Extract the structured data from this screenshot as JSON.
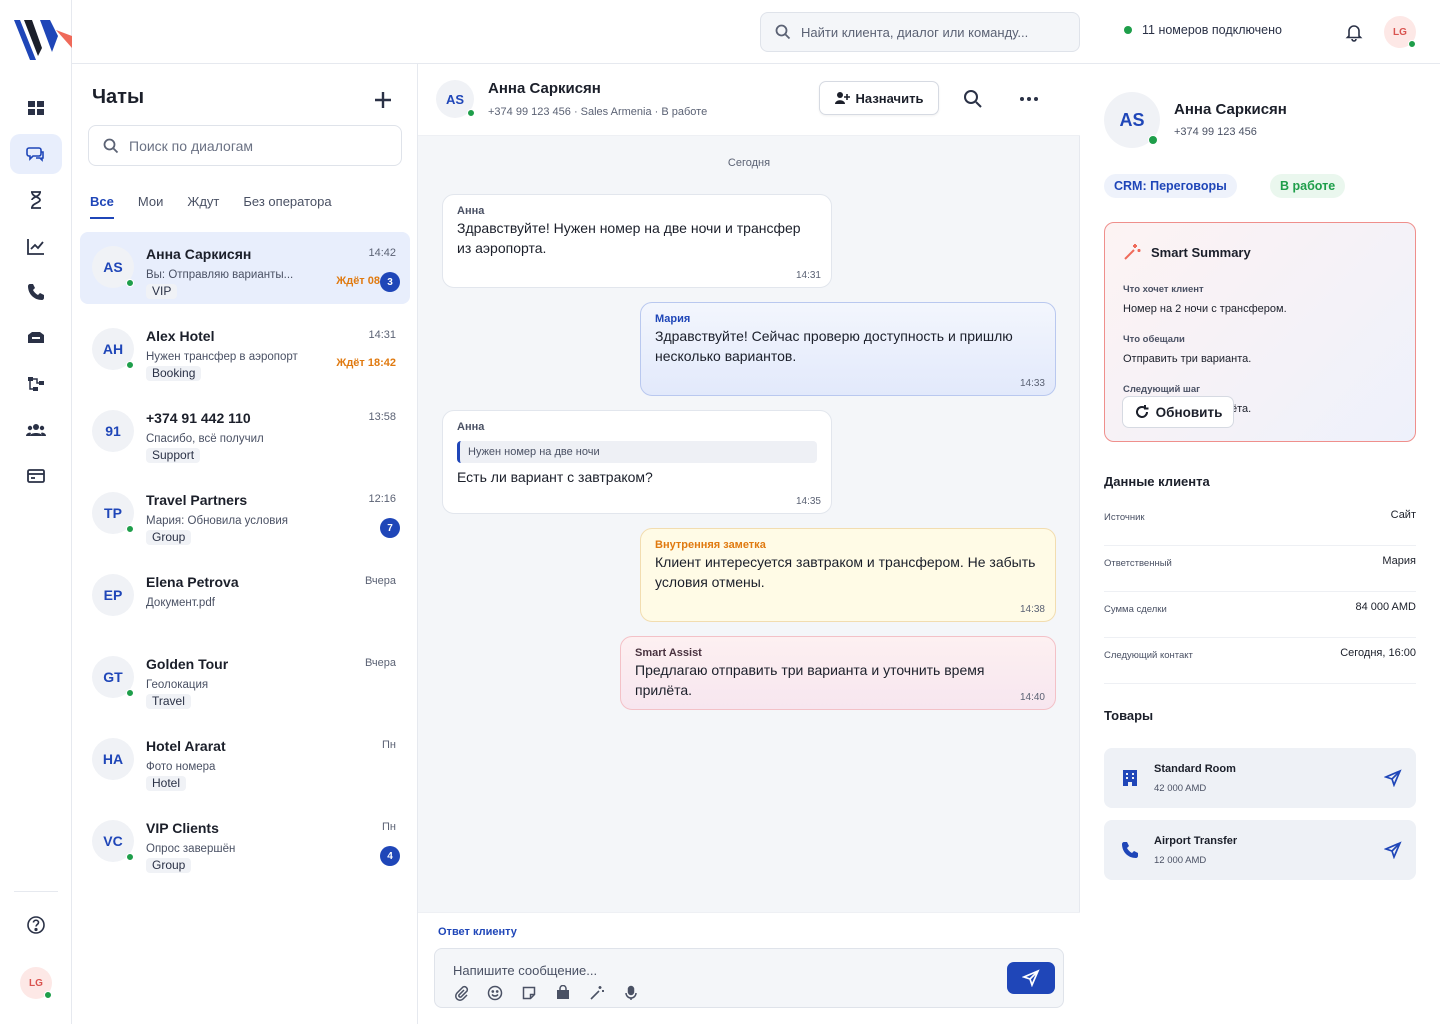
{
  "topbar": {
    "search_placeholder": "Найти клиента, диалог или команду...",
    "numbers_status": "11 номеров подключено",
    "user_initials": "LG"
  },
  "rail": {
    "items": [
      "dashboard-icon",
      "chats-icon",
      "hourglass-icon",
      "analytics-icon",
      "phone-icon",
      "inbox-icon",
      "flow-icon",
      "team-icon",
      "billing-icon"
    ],
    "help_icon": "help-icon",
    "user_initials": "LG"
  },
  "chats": {
    "title": "Чаты",
    "search_placeholder": "Поиск по диалогам",
    "filters": [
      "Все",
      "Мои",
      "Ждут",
      "Без оператора"
    ],
    "items": [
      {
        "initials": "AS",
        "name": "Анна Саркисян",
        "time": "14:42",
        "preview": "Вы: Отправляю варианты...",
        "tag": "VIP",
        "wait": "Ждёт 08",
        "badge": "3",
        "online": true
      },
      {
        "initials": "AH",
        "name": "Alex Hotel",
        "time": "14:31",
        "preview": "Нужен трансфер в аэропорт",
        "tag": "Booking",
        "wait": "Ждёт 18:42",
        "badge": "",
        "online": true
      },
      {
        "initials": "91",
        "name": "+374 91 442 110",
        "time": "13:58",
        "preview": "Спасибо, всё получил",
        "tag": "Support",
        "wait": "",
        "badge": "",
        "online": false
      },
      {
        "initials": "TP",
        "name": "Travel Partners",
        "time": "12:16",
        "preview": "Мария: Обновила условия",
        "tag": "Group",
        "wait": "",
        "badge": "7",
        "online": true
      },
      {
        "initials": "EP",
        "name": "Elena Petrova",
        "time": "Вчера",
        "preview": "Документ.pdf",
        "tag": "",
        "wait": "",
        "badge": "",
        "online": false
      },
      {
        "initials": "GT",
        "name": "Golden Tour",
        "time": "Вчера",
        "preview": "Геолокация",
        "tag": "Travel",
        "wait": "",
        "badge": "",
        "online": true
      },
      {
        "initials": "HA",
        "name": "Hotel Ararat",
        "time": "Пн",
        "preview": "Фото номера",
        "tag": "Hotel",
        "wait": "",
        "badge": "",
        "online": false
      },
      {
        "initials": "VC",
        "name": "VIP Clients",
        "time": "Пн",
        "preview": "Опрос завершён",
        "tag": "Group",
        "wait": "",
        "badge": "4",
        "online": true
      }
    ]
  },
  "conversation": {
    "initials": "AS",
    "name": "Анна Саркисян",
    "subtitle": "+374 99 123 456 · Sales Armenia · В работе",
    "assign_label": "Назначить",
    "day": "Сегодня",
    "messages": [
      {
        "kind": "in",
        "author": "Анна",
        "text": "Здравствуйте! Нужен номер на две ночи и трансфер из аэропорта.",
        "time": "14:31"
      },
      {
        "kind": "out",
        "author": "Мария",
        "text": "Здравствуйте! Сейчас проверю доступность и пришлю несколько вариантов.",
        "time": "14:33"
      },
      {
        "kind": "in",
        "author": "Анна",
        "quote": "Нужен номер на две ночи",
        "text": "Есть ли вариант с завтраком?",
        "time": "14:35"
      },
      {
        "kind": "note",
        "author": "Внутренняя заметка",
        "text": "Клиент интересуется завтраком и трансфером. Не забыть условия отмены.",
        "time": "14:38"
      },
      {
        "kind": "ai",
        "author": "Smart Assist",
        "text": "Предлагаю отправить три варианта и уточнить время прилёта.",
        "time": "14:40"
      }
    ],
    "composer_label": "Ответ клиенту",
    "composer_placeholder": "Напишите сообщение..."
  },
  "side": {
    "initials": "AS",
    "name": "Анна Саркисян",
    "phone": "+374 99 123 456",
    "crm_chip": "CRM: Переговоры",
    "status_chip": "В работе",
    "summary": {
      "title": "Smart Summary",
      "wants_label": "Что хочет клиент",
      "wants_value": "Номер на 2 ночи с трансфером.",
      "promised_label": "Что обещали",
      "promised_value": "Отправить три варианта.",
      "next_label": "Следующий шаг",
      "next_value": "ёта.",
      "refresh_label": "Обновить"
    },
    "client_title": "Данные клиента",
    "client_data": [
      {
        "k": "Источник",
        "v": "Сайт"
      },
      {
        "k": "Ответственный",
        "v": "Мария"
      },
      {
        "k": "Сумма сделки",
        "v": "84 000 AMD"
      },
      {
        "k": "Следующий контакт",
        "v": "Сегодня, 16:00"
      }
    ],
    "products_title": "Товары",
    "products": [
      {
        "name": "Standard Room",
        "price": "42 000 AMD"
      },
      {
        "name": "Airport Transfer",
        "price": "12 000 AMD"
      }
    ]
  }
}
